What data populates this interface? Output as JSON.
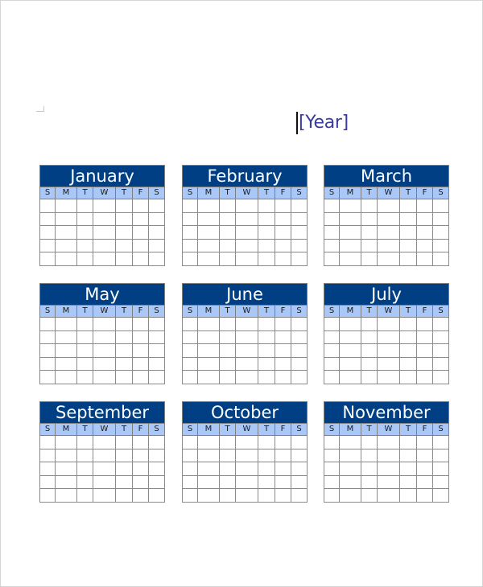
{
  "document": {
    "year_placeholder": "[Year]"
  },
  "day_headers": [
    "S",
    "M",
    "T",
    "W",
    "T",
    "F",
    "S"
  ],
  "weeks_per_month": 5,
  "colors": {
    "month_header_bg": "#003f84",
    "month_header_text": "#ffffff",
    "day_header_bg": "#a9c8f7",
    "year_text": "#3a3a9c",
    "grid_line": "#8a8a8a"
  },
  "months": [
    {
      "name": "January"
    },
    {
      "name": "February"
    },
    {
      "name": "March"
    },
    {
      "name": "May"
    },
    {
      "name": "June"
    },
    {
      "name": "July"
    },
    {
      "name": "September"
    },
    {
      "name": "October"
    },
    {
      "name": "November"
    }
  ]
}
